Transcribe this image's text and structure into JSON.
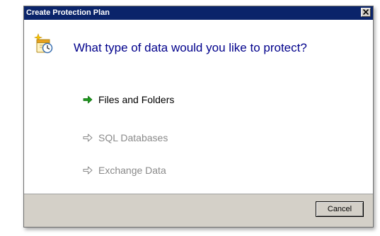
{
  "window": {
    "title": "Create Protection Plan"
  },
  "header": {
    "icon": "protection-plan-calendar-clock-icon",
    "question": "What type of data would you like to protect?"
  },
  "options": [
    {
      "label": "Files and Folders",
      "enabled": true,
      "icon": "green-arrow-icon"
    },
    {
      "label": "SQL Databases",
      "enabled": false,
      "icon": "gray-arrow-icon"
    },
    {
      "label": "Exchange Data",
      "enabled": false,
      "icon": "gray-arrow-icon"
    }
  ],
  "footer": {
    "cancel_label": "Cancel"
  },
  "colors": {
    "title_bar": "#0a246a",
    "heading_text": "#00008b",
    "enabled_arrow": "#1e9b1e",
    "disabled_text": "#8a8a8a",
    "footer_bg": "#d4d0c8"
  }
}
